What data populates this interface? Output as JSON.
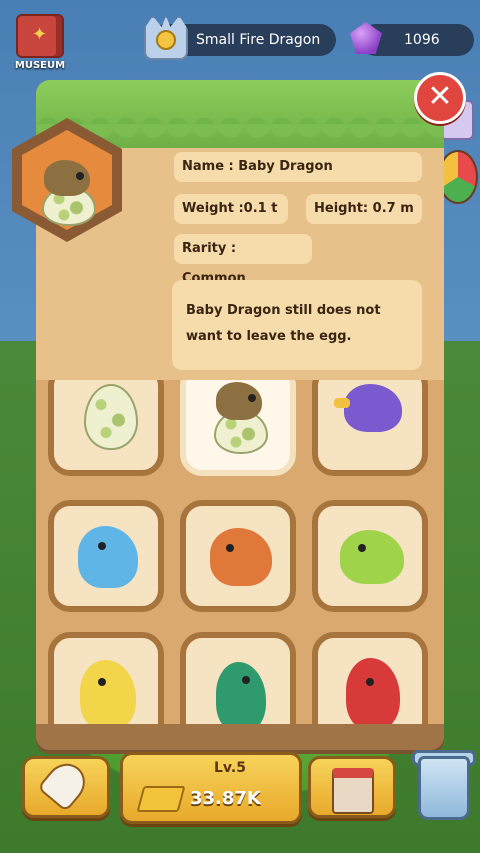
{
  "hud": {
    "museum_label": "MUSEUM",
    "dragon_title": "Small Fire Dragon",
    "gems": "1096"
  },
  "detail": {
    "name_label": "Name : Baby Dragon",
    "weight_label": "Weight :0.1 t",
    "height_label": "Height: 0.7 m",
    "rarity_label": "Rarity : Common",
    "description_line1": "Baby Dragon still does not",
    "description_line2": "want to leave the egg."
  },
  "grid": {
    "items": [
      {
        "name": "egg",
        "color": "#eef0cf"
      },
      {
        "name": "baby-dragon",
        "color": "#8d7042",
        "selected": true
      },
      {
        "name": "purple-bird-dragon",
        "color": "#7b5ad0"
      },
      {
        "name": "blue-dino",
        "color": "#5fb6e6"
      },
      {
        "name": "orange-dino",
        "color": "#e0783a"
      },
      {
        "name": "green-dino",
        "color": "#9fd34a"
      },
      {
        "name": "yellow-dino",
        "color": "#f2d548"
      },
      {
        "name": "teal-dino",
        "color": "#2f9a6e"
      },
      {
        "name": "red-dragon",
        "color": "#d83a3a"
      }
    ]
  },
  "bottom_bar": {
    "level": "Lv.5",
    "coins": "33.87K"
  },
  "colors": {
    "panel": "#c99b66",
    "accent_red": "#e0463e",
    "button_gold": "#f7d35a"
  }
}
